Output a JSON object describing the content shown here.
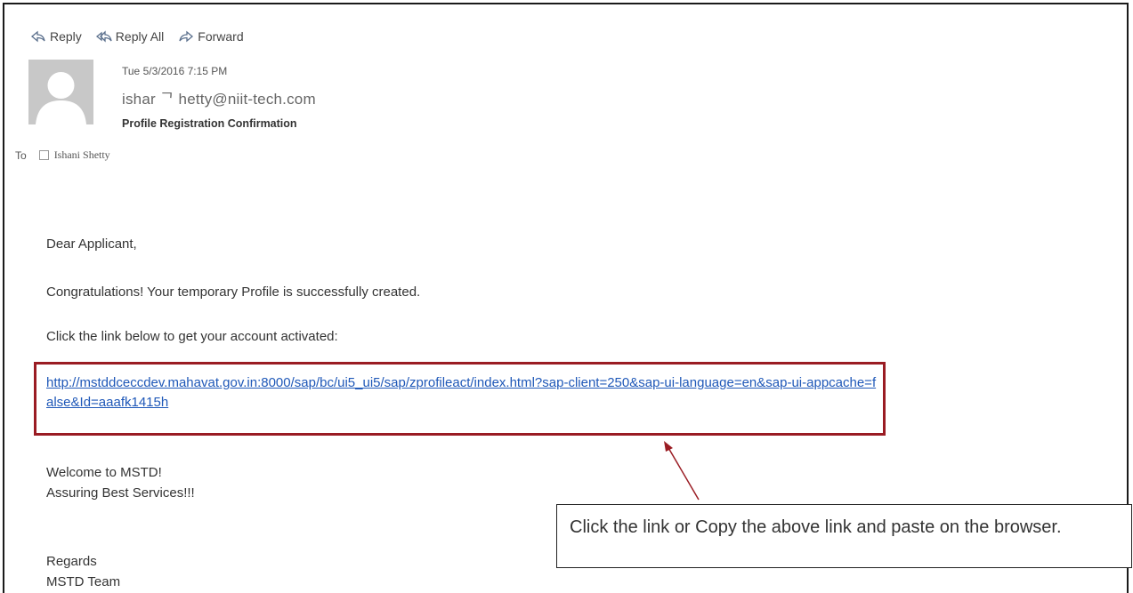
{
  "toolbar": {
    "reply_label": "Reply",
    "reply_all_label": "Reply All",
    "forward_label": "Forward"
  },
  "message": {
    "date": "Tue 5/3/2016 7:15 PM",
    "sender": "ishar  ᄀ  hetty@niit-tech.com",
    "subject": "Profile Registration Confirmation",
    "to_label": "To",
    "to_name": "Ishani Shetty"
  },
  "body": {
    "greeting": "Dear Applicant,",
    "congrats": "Congratulations! Your temporary Profile is successfully created.",
    "instruction": "Click the link below to get your account activated:",
    "link": "http://mstddceccdev.mahavat.gov.in:8000/sap/bc/ui5_ui5/sap/zprofileact/index.html?sap-client=250&sap-ui-language=en&sap-ui-appcache=false&Id=aaafk1415h",
    "welcome": "Welcome to MSTD!",
    "assuring": "Assuring Best Services!!!",
    "regards": "Regards",
    "team": "MSTD Team"
  },
  "annotation": {
    "callout_text": "Click the link or Copy the above link and paste on the browser.",
    "box_color": "#9a1c23",
    "arrow_color": "#9a1c23"
  }
}
